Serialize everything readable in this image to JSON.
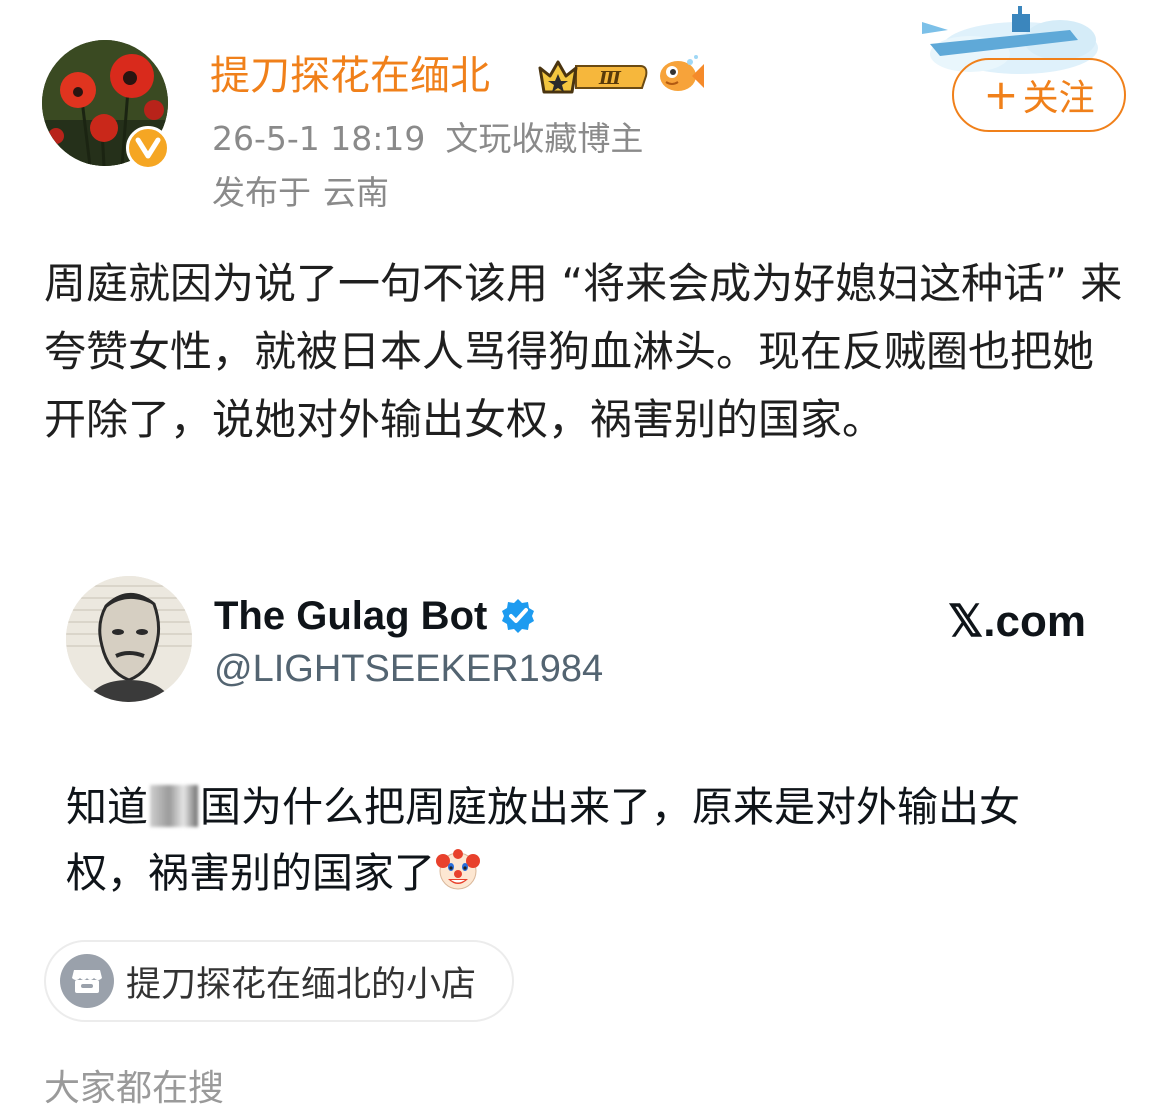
{
  "author": {
    "name": "提刀探花在缅北",
    "level_badge": "Ⅲ",
    "timestamp": "26-5-1 18:19",
    "title": "文玩收藏博主",
    "location_prefix": "发布于",
    "location": "云南"
  },
  "follow_button": {
    "plus": "+",
    "label": "关注"
  },
  "post": {
    "text": "周庭就因为说了一句不该用 “将来会成为好媳妇这种话” 来夸赞女性，就被日本人骂得狗血淋头。现在反贼圈也把她开除了，说她对外输出女权，祸害别的国家。"
  },
  "embedded_tweet": {
    "display_name": "The Gulag Bot",
    "handle": "@LIGHTSEEKER1984",
    "source": "𝕏.com",
    "text_before": "知道",
    "text_after": "国为什么把周庭放出来了，原来是对外输出女权，祸害别的国家了"
  },
  "shop_chip": {
    "label": "提刀探花在缅北的小店"
  },
  "section": {
    "everyone_searching": "大家都在搜"
  },
  "icons": {
    "verified": "verified-v-icon",
    "crown": "crown-badge-icon",
    "fish": "fish-badge-icon",
    "tweet_verified": "tweet-verified-icon",
    "clown": "clown-face-icon",
    "shop": "shop-icon"
  },
  "colors": {
    "accent": "#f0801a",
    "meta_gray": "#8a8a8a",
    "tweet_blue": "#1d9bf0"
  }
}
